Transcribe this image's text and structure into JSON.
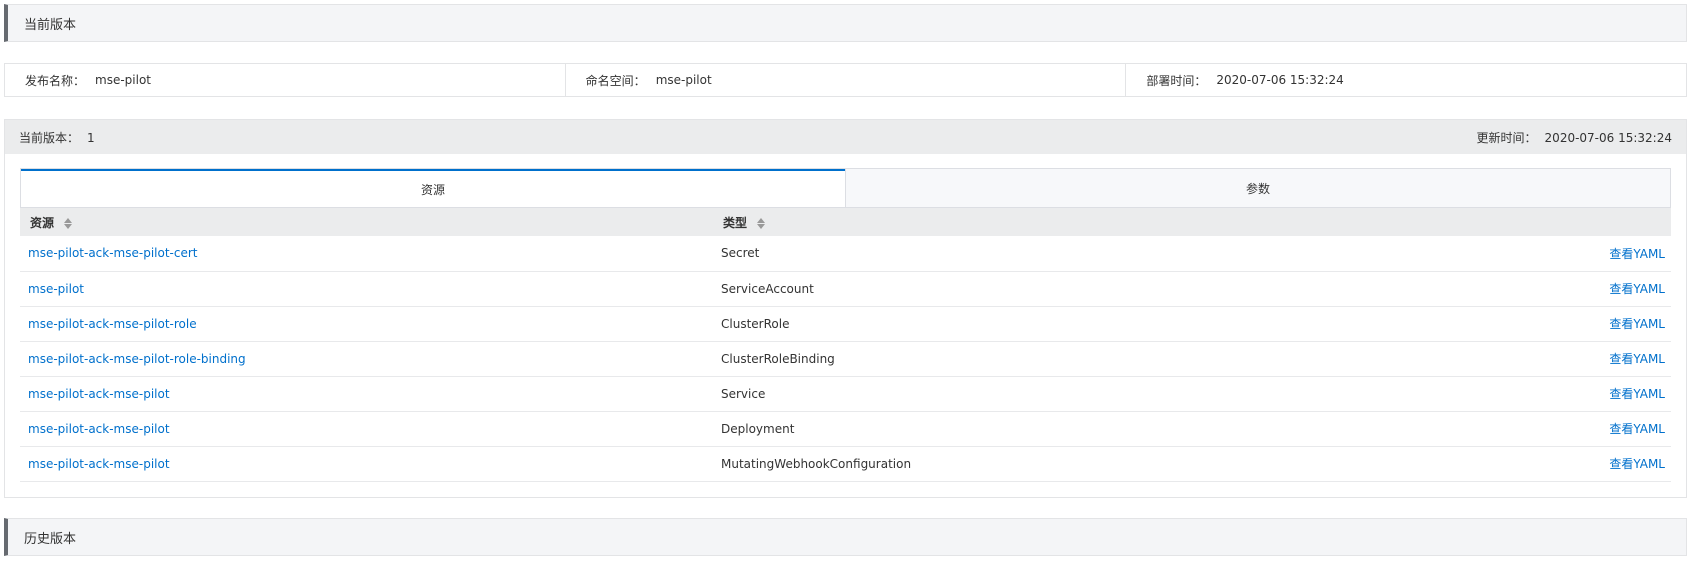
{
  "current_header": "当前版本",
  "history_header": "历史版本",
  "release_info": {
    "name_label": "发布名称：",
    "name_value": "mse-pilot",
    "namespace_label": "命名空间：",
    "namespace_value": "mse-pilot",
    "deploy_time_label": "部署时间：",
    "deploy_time_value": "2020-07-06 15:32:24"
  },
  "version_bar": {
    "version_label": "当前版本：",
    "version_value": "1",
    "update_label": "更新时间：",
    "update_value": "2020-07-06 15:32:24"
  },
  "tabs": [
    {
      "label": "资源",
      "active": true
    },
    {
      "label": "参数",
      "active": false
    }
  ],
  "table": {
    "columns": [
      "资源",
      "类型"
    ],
    "action_label": "查看YAML",
    "rows": [
      {
        "resource": "mse-pilot-ack-mse-pilot-cert",
        "type": "Secret"
      },
      {
        "resource": "mse-pilot",
        "type": "ServiceAccount"
      },
      {
        "resource": "mse-pilot-ack-mse-pilot-role",
        "type": "ClusterRole"
      },
      {
        "resource": "mse-pilot-ack-mse-pilot-role-binding",
        "type": "ClusterRoleBinding"
      },
      {
        "resource": "mse-pilot-ack-mse-pilot",
        "type": "Service"
      },
      {
        "resource": "mse-pilot-ack-mse-pilot",
        "type": "Deployment"
      },
      {
        "resource": "mse-pilot-ack-mse-pilot",
        "type": "MutatingWebhookConfiguration"
      }
    ]
  },
  "colors": {
    "link": "#0070cc",
    "accent_bar": "#666a70"
  }
}
